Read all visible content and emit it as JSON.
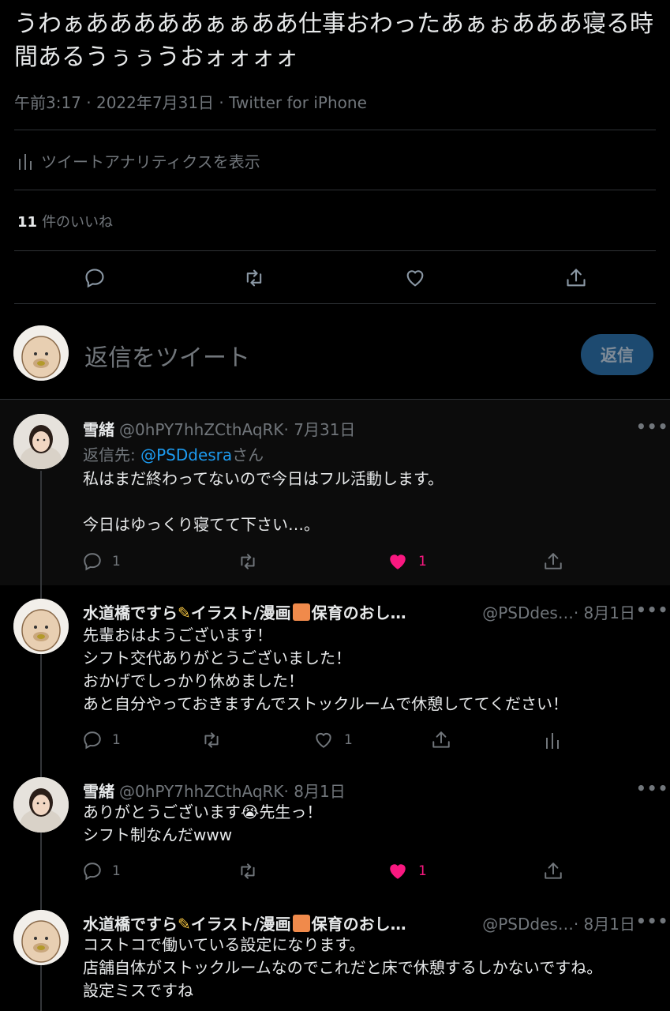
{
  "main_tweet": {
    "text": "うわぁあああああぁぁああ仕事おわったあぁぉあああ寝る時間あるうぅぅうおォォォォ",
    "meta": "午前3:17 · 2022年7月31日 · Twitter for iPhone",
    "analytics_label": "ツイートアナリティクスを表示",
    "likes_count": "11",
    "likes_label": "件のいいね"
  },
  "composer": {
    "placeholder": "返信をツイート",
    "button_label": "返信"
  },
  "replies": [
    {
      "name": "雪緒",
      "handle": "@0hPY7hhZCthAqRK",
      "date": " · 7月31日",
      "replying_prefix": "返信先: ",
      "replying_mention": "@PSDdesra",
      "replying_suffix": "さん",
      "text": "私はまだ終わってないので今日はフル活動します。\n\n今日はゆっくり寝てて下さい…。",
      "reply_count": "1",
      "like_count": "1",
      "liked": true
    },
    {
      "name_a": "水道橋ですら",
      "name_b": "イラスト/漫画",
      "name_c": "保育のおし…",
      "handle": "@PSDdes…",
      "date": " · 8月1日",
      "text": "先輩おはようございます！\nシフト交代ありがとうございました！\nおかげでしっかり休めました！\nあと自分やっておきますんでストックルームで休憩しててください！",
      "reply_count": "1",
      "like_count": "1",
      "liked": false
    },
    {
      "name": "雪緒",
      "handle": "@0hPY7hhZCthAqRK",
      "date": " · 8月1日",
      "text_a": "ありがとうございます",
      "text_emoji": "😭",
      "text_b": "先生っ！\nシフト制なんだwww",
      "reply_count": "1",
      "like_count": "1",
      "liked": true
    },
    {
      "name_a": "水道橋ですら",
      "name_b": "イラスト/漫画",
      "name_c": "保育のおし…",
      "handle": "@PSDdes…",
      "date": " · 8月1日",
      "text": "コストコで働いている設定になります。\n店舗自体がストックルームなのでこれだと床で休憩するしかないですね。\n設定ミスですね"
    }
  ],
  "more_label": "•••",
  "colors": {
    "accent": "#1d9bf0",
    "like": "#f91880",
    "muted": "#71767b",
    "reply_button": "#1d4a70"
  }
}
